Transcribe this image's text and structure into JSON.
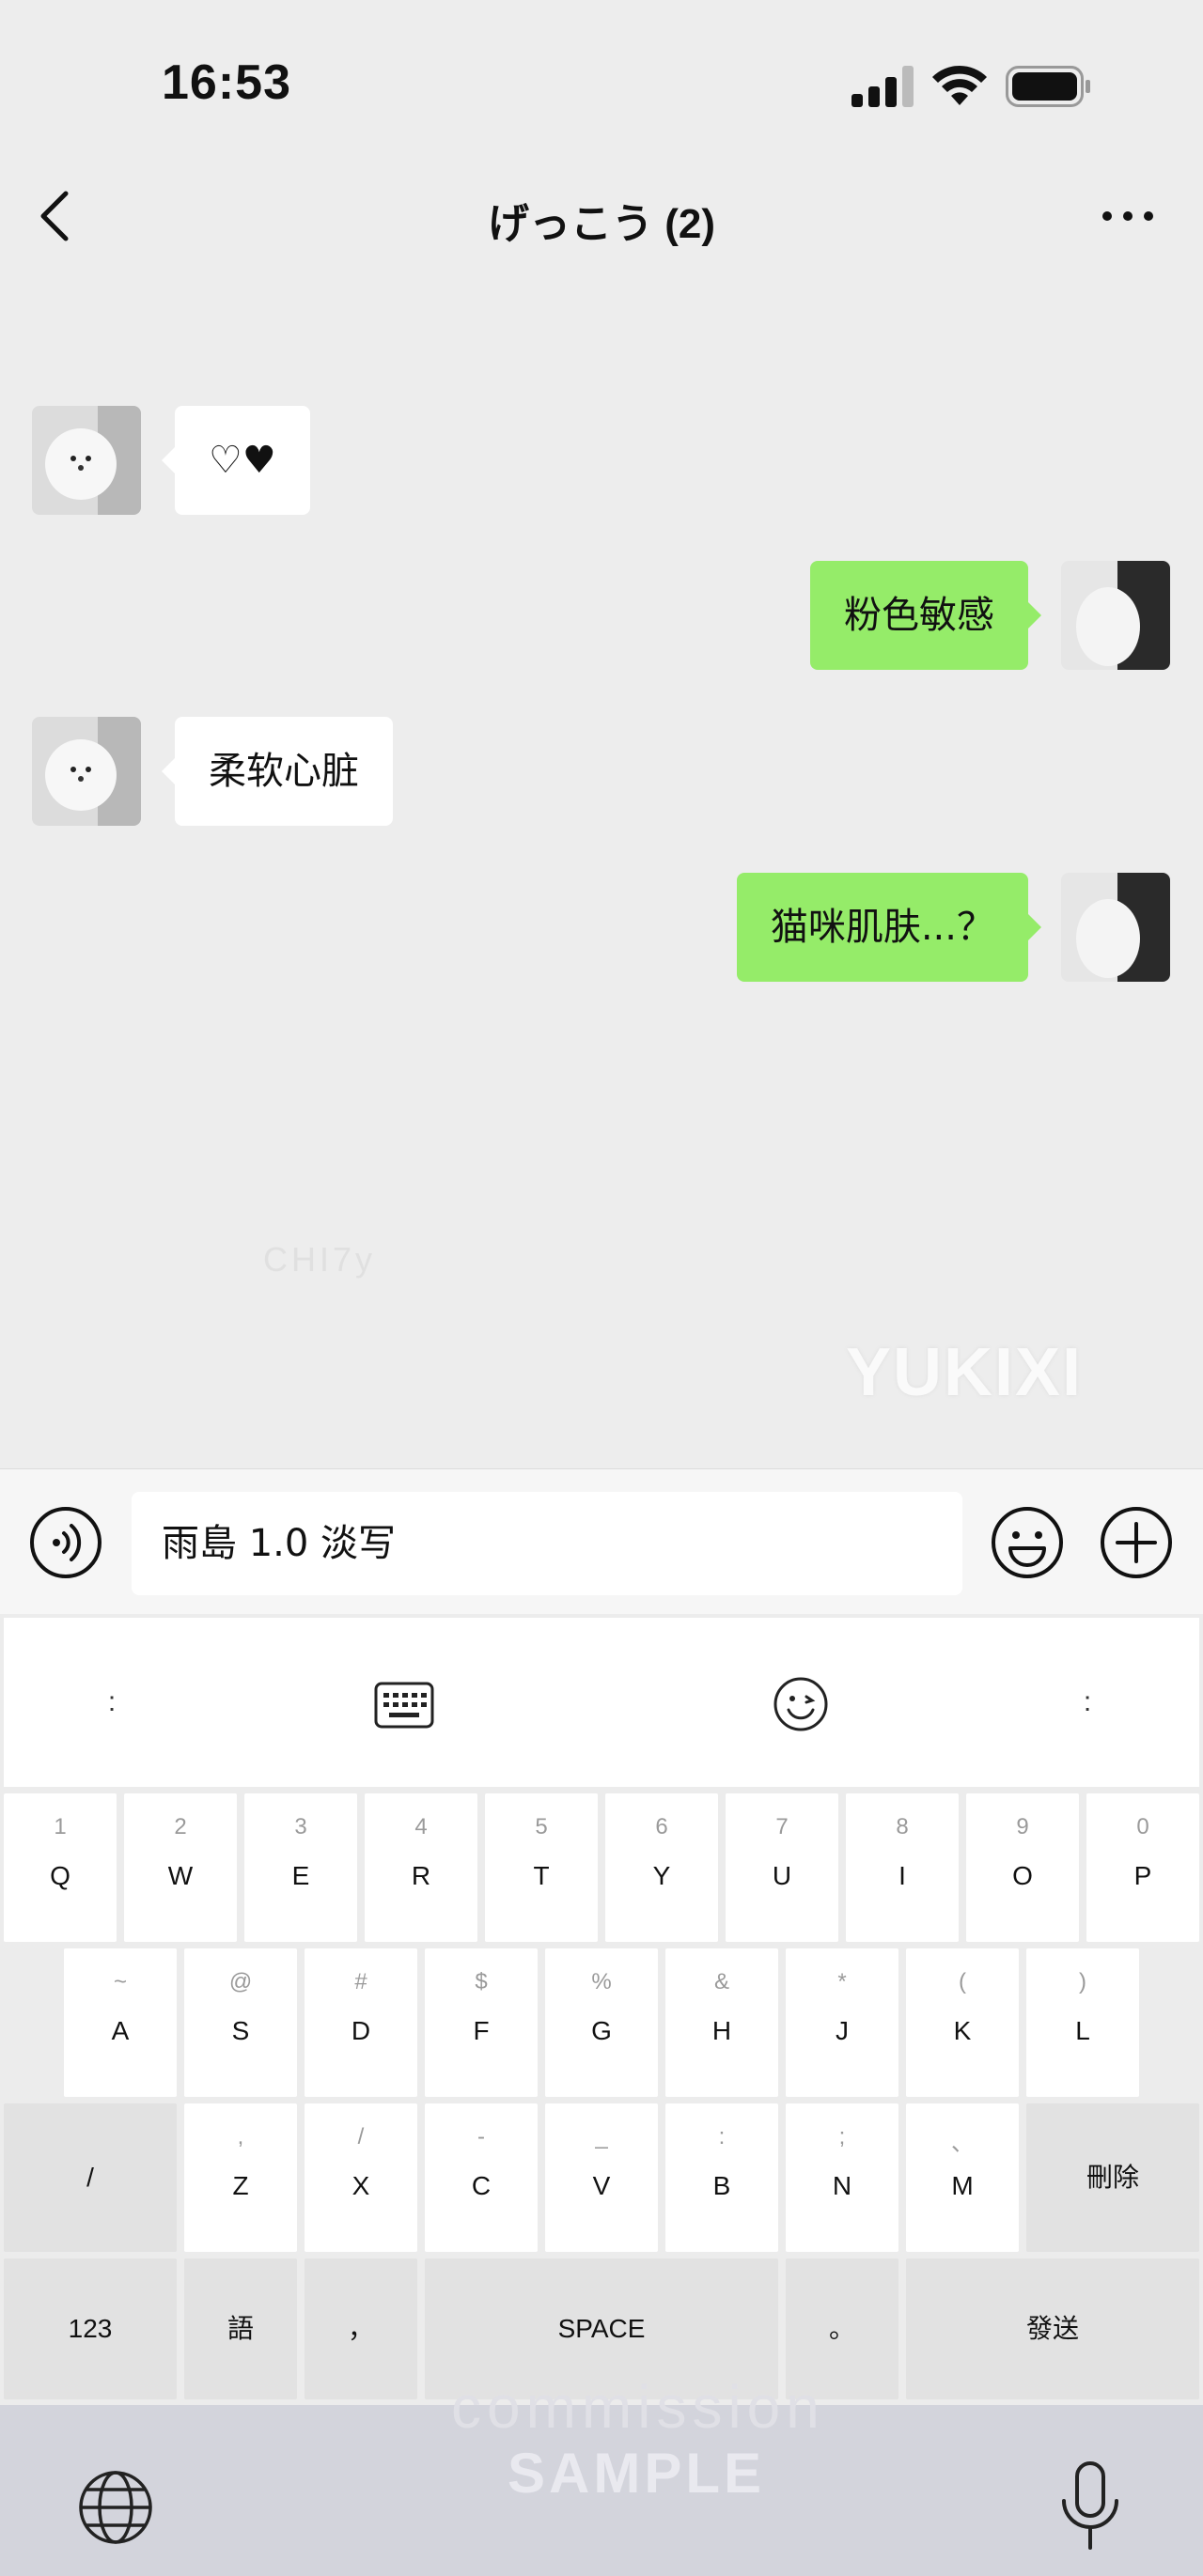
{
  "status": {
    "time": "16:53"
  },
  "nav": {
    "title": "げっこう (2)"
  },
  "messages": [
    {
      "side": "in",
      "text": "♡♥"
    },
    {
      "side": "out",
      "text": "粉色敏感"
    },
    {
      "side": "in",
      "text": "柔软心脏"
    },
    {
      "side": "out",
      "text": "猫咪肌肤...？"
    }
  ],
  "watermarks": {
    "small": "CHI7y",
    "big": "YUKIXI",
    "commission": "commission",
    "sample": "SAMPLE"
  },
  "input": {
    "value": "雨島 1.0 淡写"
  },
  "keyboard": {
    "toolbar": {
      "left": ":",
      "right": ":"
    },
    "row1": [
      {
        "sub": "1",
        "main": "Q"
      },
      {
        "sub": "2",
        "main": "W"
      },
      {
        "sub": "3",
        "main": "E"
      },
      {
        "sub": "4",
        "main": "R"
      },
      {
        "sub": "5",
        "main": "T"
      },
      {
        "sub": "6",
        "main": "Y"
      },
      {
        "sub": "7",
        "main": "U"
      },
      {
        "sub": "8",
        "main": "I"
      },
      {
        "sub": "9",
        "main": "O"
      },
      {
        "sub": "0",
        "main": "P"
      }
    ],
    "row2": [
      {
        "sub": "~",
        "main": "A"
      },
      {
        "sub": "@",
        "main": "S"
      },
      {
        "sub": "#",
        "main": "D"
      },
      {
        "sub": "$",
        "main": "F"
      },
      {
        "sub": "%",
        "main": "G"
      },
      {
        "sub": "&",
        "main": "H"
      },
      {
        "sub": "*",
        "main": "J"
      },
      {
        "sub": "(",
        "main": "K"
      },
      {
        "sub": ")",
        "main": "L"
      }
    ],
    "row3": [
      {
        "sub": ",",
        "main": "Z"
      },
      {
        "sub": "/",
        "main": "X"
      },
      {
        "sub": "-",
        "main": "C"
      },
      {
        "sub": "_",
        "main": "V"
      },
      {
        "sub": ":",
        "main": "B"
      },
      {
        "sub": ";",
        "main": "N"
      },
      {
        "sub": "、",
        "main": "M"
      }
    ],
    "slash": "/",
    "delete": "刪除",
    "num": "123",
    "lang": "語",
    "comma": "，",
    "space": "SPACE",
    "period": "。",
    "send": "發送"
  }
}
